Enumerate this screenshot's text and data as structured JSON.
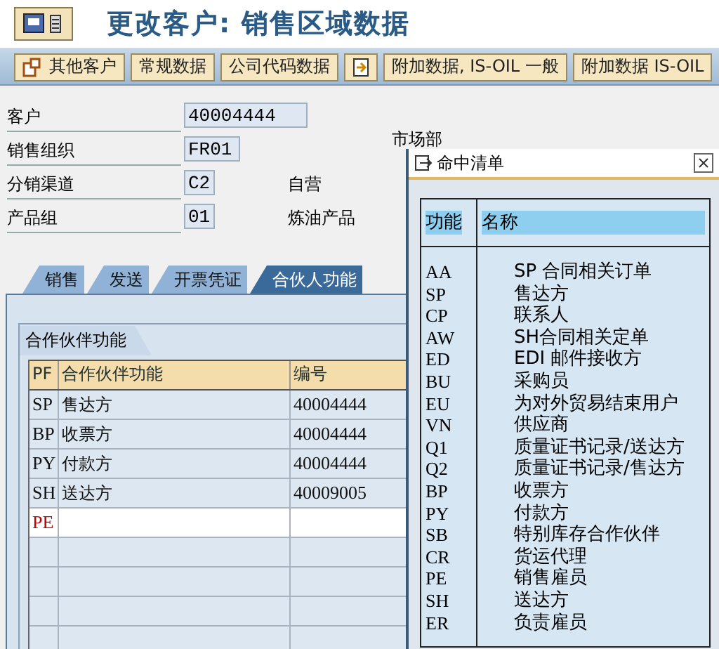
{
  "title": "更改客户: 销售区域数据",
  "toolbar": [
    {
      "kind": "icon-text",
      "label": "其他客户"
    },
    {
      "kind": "text",
      "label": "常规数据"
    },
    {
      "kind": "text",
      "label": "公司代码数据"
    },
    {
      "kind": "icon"
    },
    {
      "kind": "text",
      "label": "附加数据, IS-OIL 一般"
    },
    {
      "kind": "text",
      "label": "附加数据 IS-OIL"
    }
  ],
  "header_fields": [
    {
      "label": "客户",
      "value": "40004444"
    },
    {
      "label": "销售组织",
      "value": "FR01",
      "side_label": "市场部"
    },
    {
      "label": "分销渠道",
      "value": "C2",
      "description": "自营"
    },
    {
      "label": "产品组",
      "value": "01",
      "description": "炼油产品"
    }
  ],
  "tabs": [
    {
      "label": "销售",
      "selected": false
    },
    {
      "label": "发送",
      "selected": false
    },
    {
      "label": "开票凭证",
      "selected": false
    },
    {
      "label": "合伙人功能",
      "selected": true
    }
  ],
  "group_title": "合作伙伴功能",
  "table": {
    "columns": [
      "PF",
      "合作伙伴功能",
      "编号"
    ],
    "rows": [
      {
        "kind": "data",
        "pf": "SP",
        "function": "售达方",
        "number": "40004444"
      },
      {
        "kind": "data",
        "pf": "BP",
        "function": "收票方",
        "number": "40004444"
      },
      {
        "kind": "data",
        "pf": "PY",
        "function": "付款方",
        "number": "40004444"
      },
      {
        "kind": "data",
        "pf": "SH",
        "function": "送达方",
        "number": "40009005"
      },
      {
        "kind": "entry",
        "pf": "PE"
      }
    ]
  },
  "popup": {
    "title": "命中清单",
    "columns": [
      "功能",
      "名称"
    ],
    "items": [
      {
        "code": "AA",
        "name": "SP 合同相关订单"
      },
      {
        "code": "SP",
        "name": "售达方"
      },
      {
        "code": "CP",
        "name": "联系人"
      },
      {
        "code": "AW",
        "name": "SH合同相关定单"
      },
      {
        "code": "ED",
        "name": "EDI 邮件接收方"
      },
      {
        "code": "BU",
        "name": "采购员"
      },
      {
        "code": "EU",
        "name": "为对外贸易结束用户"
      },
      {
        "code": "VN",
        "name": "供应商"
      },
      {
        "code": "Q1",
        "name": "质量证书记录/送达方"
      },
      {
        "code": "Q2",
        "name": "质量证书记录/售达方"
      },
      {
        "code": "BP",
        "name": "收票方"
      },
      {
        "code": "PY",
        "name": "付款方"
      },
      {
        "code": "SB",
        "name": "特别库存合作伙伴"
      },
      {
        "code": "CR",
        "name": "货运代理"
      },
      {
        "code": "PE",
        "name": "销售雇员"
      },
      {
        "code": "SH",
        "name": "送达方"
      },
      {
        "code": "ER",
        "name": "负责雇员"
      }
    ]
  }
}
